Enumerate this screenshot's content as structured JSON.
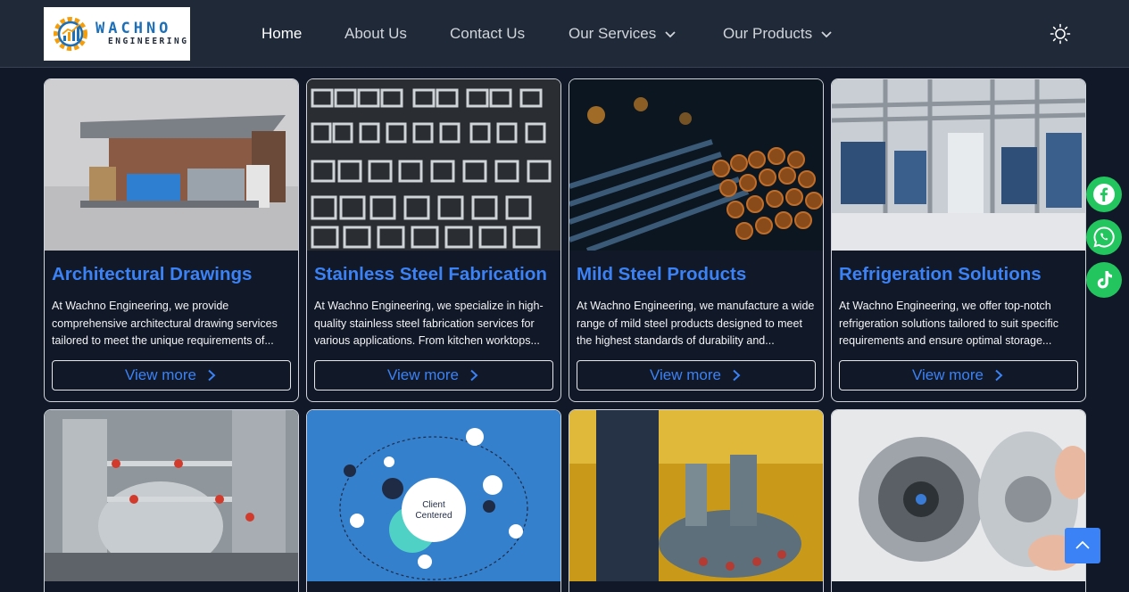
{
  "brand": {
    "name": "WACHNO",
    "sub": "ENGINEERING",
    "accent": "#1d6fb8"
  },
  "nav": {
    "home": "Home",
    "about": "About Us",
    "contact": "Contact Us",
    "services": "Our Services",
    "products": "Our Products"
  },
  "cards": [
    {
      "title": "Architectural Drawings",
      "text": "At Wachno Engineering, we provide comprehensive architectural drawing services tailored to meet the unique requirements of...",
      "button": "View more"
    },
    {
      "title": "Stainless Steel Fabrication",
      "text": "At Wachno Engineering, we specialize in high-quality stainless steel fabrication services for various applications. From kitchen worktops...",
      "button": "View more"
    },
    {
      "title": "Mild Steel Products",
      "text": "At Wachno Engineering, we manufacture a wide range of mild steel products designed to meet the highest standards of durability and...",
      "button": "View more"
    },
    {
      "title": "Refrigeration Solutions",
      "text": "At Wachno Engineering, we offer top-notch refrigeration solutions tailored to suit specific requirements and ensure optimal storage...",
      "button": "View more"
    }
  ],
  "client_centered": {
    "line1": "Client",
    "line2": "Centered"
  },
  "colors": {
    "background": "#111827",
    "header": "#1f2937",
    "accent": "#3b82f6",
    "social": "#22c55e"
  },
  "icons": [
    "sun-icon",
    "chevron-down-icon",
    "chevron-right-icon",
    "facebook-icon",
    "whatsapp-icon",
    "tiktok-icon",
    "arrow-up-icon"
  ]
}
